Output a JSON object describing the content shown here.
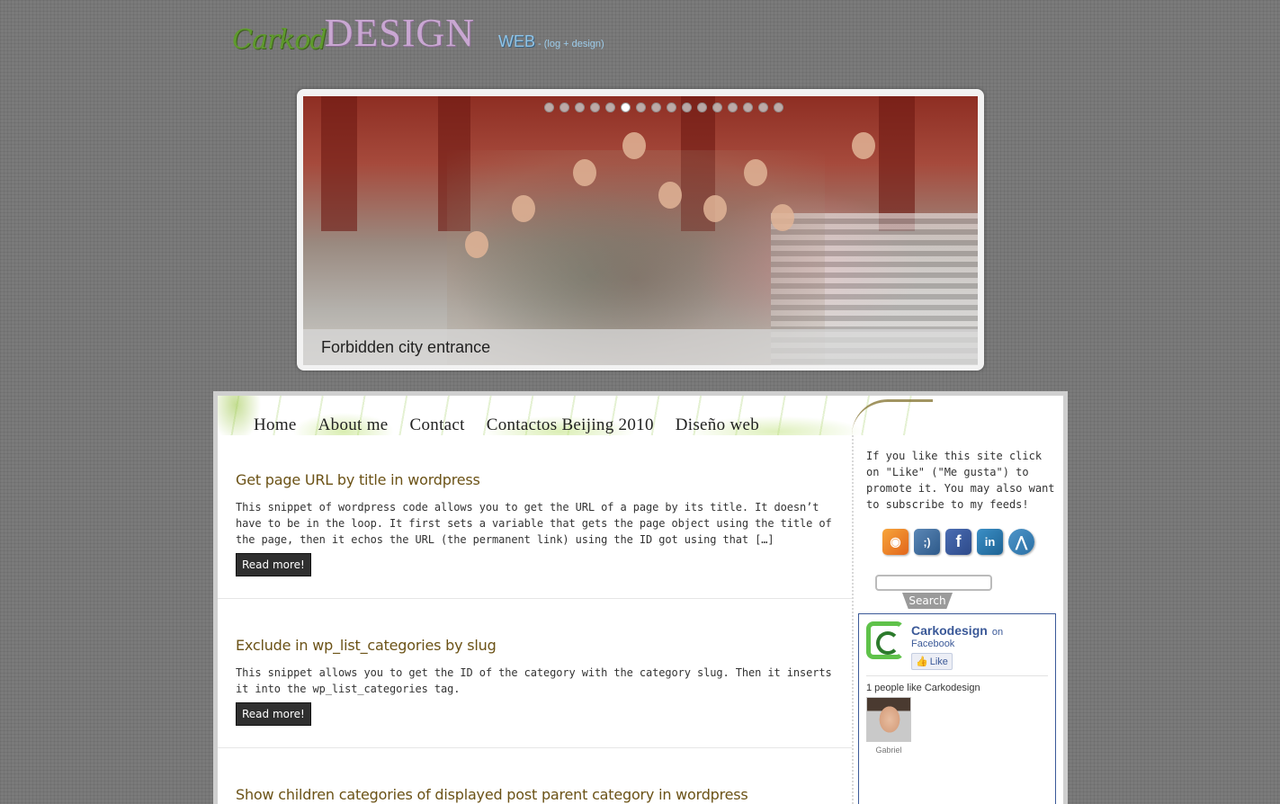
{
  "header": {
    "logo_part1": "Carkod",
    "logo_part2": "DESIGN",
    "tagline_main": "WEB",
    "tagline_sub": "- (log + design)"
  },
  "slider": {
    "caption": "Forbidden city entrance",
    "dot_count": 16,
    "active_dot": 5
  },
  "nav": {
    "items": [
      "Home",
      "About me",
      "Contact",
      "Contactos Beijing 2010",
      "Diseño web"
    ]
  },
  "posts": [
    {
      "title": "Get page URL by title in wordpress",
      "excerpt": "This snippet of wordpress code allows you to get the URL of a page by its title. It doesn’t have to be in the loop. It first sets a variable that gets the page object using the title of the page, then it echos the URL (the permanent link) using the ID got using that […]",
      "read_more": "Read more!"
    },
    {
      "title": "Exclude in wp_list_categories by slug",
      "excerpt": "This snippet allows you to get the ID of the category with the category slug. Then it inserts it into the wp_list_categories tag.",
      "read_more": "Read more!"
    },
    {
      "title": "Show children categories of displayed post parent category in wordpress",
      "excerpt": "",
      "read_more": ""
    }
  ],
  "sidebar": {
    "intro": "If you like this site click on \"Like\" (\"Me gusta\") to promote it. You may also want to subscribe to my feeds!",
    "social_icons": [
      "rss-icon",
      "tuenti-icon",
      "facebook-icon",
      "linkedin-icon",
      "bloglines-icon"
    ],
    "search_button": "Search",
    "facebook": {
      "page_name": "Carkodesign",
      "on": "on",
      "platform": "Facebook",
      "like_label": "Like",
      "count_text": "1 people like Carkodesign",
      "fan_name": "Gabriel"
    }
  }
}
